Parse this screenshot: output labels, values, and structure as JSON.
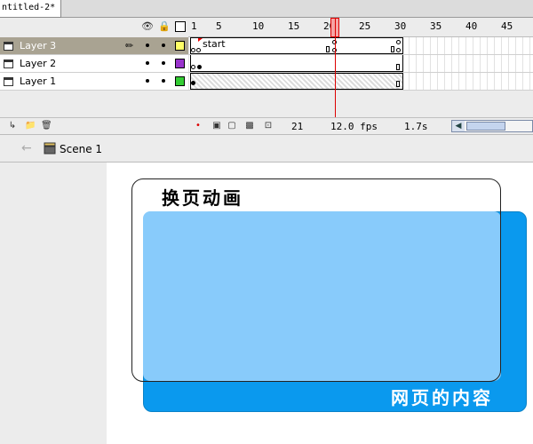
{
  "document_tab": {
    "title": "ntitled-2*"
  },
  "timeline": {
    "ruler_labels": [
      "1",
      "5",
      "10",
      "15",
      "20",
      "25",
      "30",
      "35",
      "40",
      "45"
    ],
    "layers": [
      {
        "name": "Layer 3",
        "swatch_color": "#ffff66",
        "selected": true,
        "frame_label": "start"
      },
      {
        "name": "Layer 2",
        "swatch_color": "#9933cc",
        "selected": false
      },
      {
        "name": "Layer 1",
        "swatch_color": "#33cc33",
        "selected": false
      }
    ],
    "current_frame": "21",
    "frame_rate": "12.0 fps",
    "elapsed_time": "1.7s",
    "icons": {
      "eye": "eye-icon",
      "lock": "lock-icon",
      "outline": "outline-icon"
    }
  },
  "editbar": {
    "scene_name": "Scene 1"
  },
  "stage": {
    "card_title": "换页动画",
    "content_label": "网页的内容",
    "colors": {
      "blue_panel": "#0a99ee",
      "light_panel": "#88cbfb",
      "background": "#ffffff"
    }
  }
}
